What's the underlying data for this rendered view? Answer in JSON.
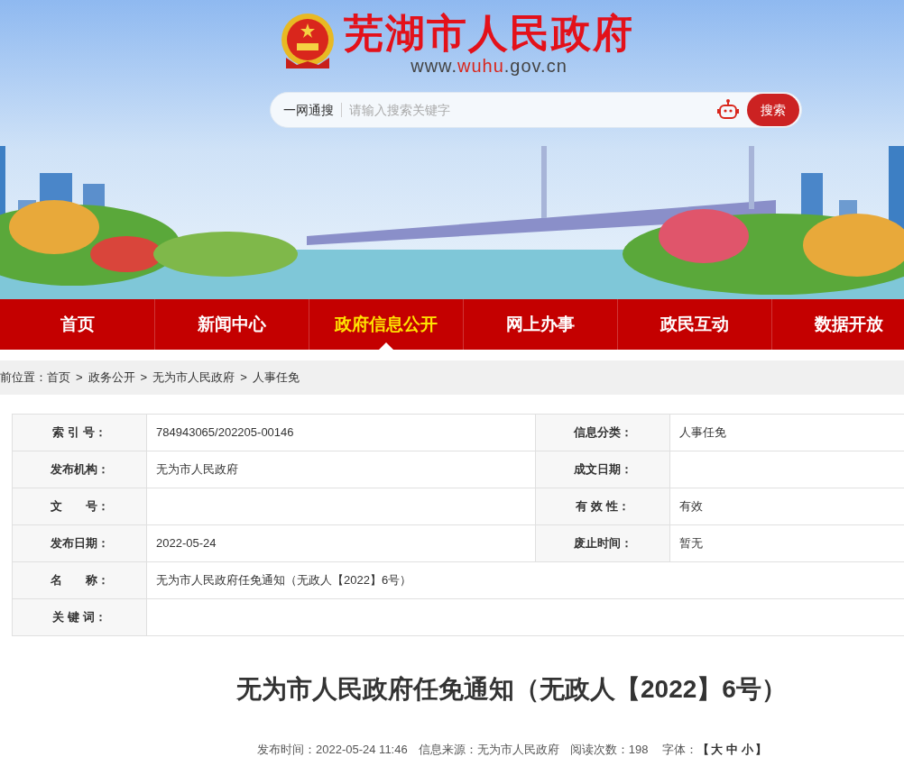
{
  "header": {
    "site_name": "芜湖市人民政府",
    "site_url_prefix": "www.",
    "site_url_highlight": "wuhu",
    "site_url_suffix": ".gov.cn",
    "search": {
      "scope": "一网通搜",
      "placeholder": "请输入搜索关键字",
      "button": "搜索"
    }
  },
  "nav": [
    {
      "label": "首页",
      "selected": false
    },
    {
      "label": "新闻中心",
      "selected": false
    },
    {
      "label": "政府信息公开",
      "selected": true
    },
    {
      "label": "网上办事",
      "selected": false
    },
    {
      "label": "政民互动",
      "selected": false
    },
    {
      "label": "数据开放",
      "selected": false
    }
  ],
  "breadcrumb": {
    "label": "前位置：",
    "separator": ">",
    "items": [
      "首页",
      "政务公开",
      "无为市人民政府",
      "人事任免"
    ]
  },
  "info_table": [
    [
      {
        "label": "索 引 号：",
        "value": "784943065/202205-00146"
      },
      {
        "label": "信息分类：",
        "value": "人事任免"
      }
    ],
    [
      {
        "label": "发布机构：",
        "value": "无为市人民政府"
      },
      {
        "label": "成文日期："
      }
    ],
    [
      {
        "label": "文　　号："
      },
      {
        "label": "有 效 性：",
        "value": "有效"
      }
    ],
    [
      {
        "label": "发布日期：",
        "value": "2022-05-24"
      },
      {
        "label": "废止时间：",
        "value": "暂无"
      }
    ],
    [
      {
        "label": "名　　称：",
        "value": "无为市人民政府任免通知（无政人【2022】6号）"
      }
    ],
    [
      {
        "label": "关 键 词："
      }
    ]
  ],
  "article": {
    "title": "无为市人民政府任免通知（无政人【2022】6号）",
    "meta": [
      {
        "label": "发布时间：",
        "value": "2022-05-24 11:46"
      },
      {
        "label": "信息来源：",
        "value": "无为市人民政府"
      },
      {
        "label": "阅读次数：",
        "value": "198"
      }
    ],
    "font_size": {
      "label": "字体：",
      "open": "【",
      "sizes": [
        "大",
        "中",
        "小"
      ],
      "close": "】"
    }
  }
}
